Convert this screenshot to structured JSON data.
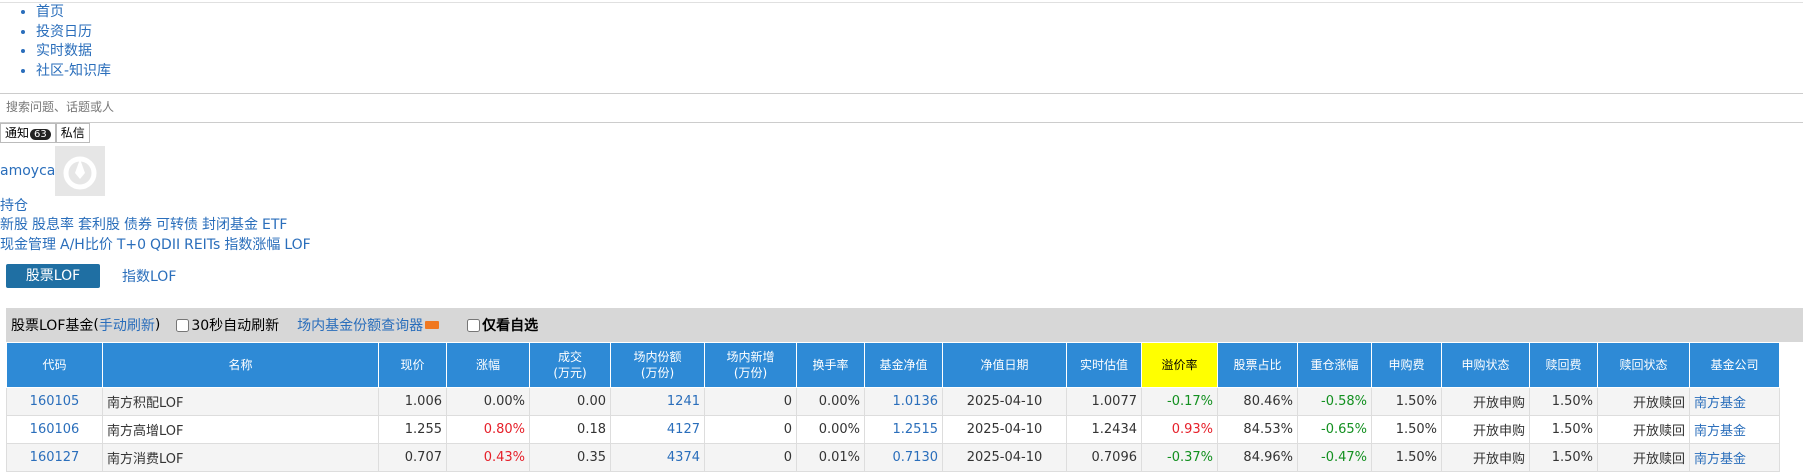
{
  "nav": {
    "items": [
      "首页",
      "投资日历",
      "实时数据",
      "社区-知识库"
    ]
  },
  "search": {
    "placeholder": "搜索问题、话题或人"
  },
  "messages": {
    "notify_label": "通知",
    "notify_count": "63",
    "private_label": "私信"
  },
  "user": {
    "name": "amoyca"
  },
  "hold_link": "持仓",
  "links_row1": [
    "新股",
    "股息率",
    "套利股",
    "债券",
    "可转债",
    "封闭基金",
    "ETF"
  ],
  "links_row2": [
    "现金管理",
    "A/H比价",
    "T+0",
    "QDII",
    "REITs",
    "指数涨幅",
    "LOF"
  ],
  "subtabs": {
    "active": "股票LOF",
    "other": "指数LOF"
  },
  "panel": {
    "title": "股票LOF基金",
    "refresh_label": "手动刷新",
    "auto_refresh_label": "30秒自动刷新",
    "query_link": "场内基金份额查询器",
    "only_watch_label": "仅看自选"
  },
  "table": {
    "headers": [
      {
        "l1": "代码",
        "l2": ""
      },
      {
        "l1": "名称",
        "l2": ""
      },
      {
        "l1": "现价",
        "l2": ""
      },
      {
        "l1": "涨幅",
        "l2": ""
      },
      {
        "l1": "成交",
        "l2": "(万元)"
      },
      {
        "l1": "场内份额",
        "l2": "(万份)"
      },
      {
        "l1": "场内新增",
        "l2": "(万份)"
      },
      {
        "l1": "换手率",
        "l2": ""
      },
      {
        "l1": "基金净值",
        "l2": ""
      },
      {
        "l1": "净值日期",
        "l2": ""
      },
      {
        "l1": "实时估值",
        "l2": ""
      },
      {
        "l1": "溢价率",
        "l2": ""
      },
      {
        "l1": "股票占比",
        "l2": ""
      },
      {
        "l1": "重仓涨幅",
        "l2": ""
      },
      {
        "l1": "申购费",
        "l2": ""
      },
      {
        "l1": "申购状态",
        "l2": ""
      },
      {
        "l1": "赎回费",
        "l2": ""
      },
      {
        "l1": "赎回状态",
        "l2": ""
      },
      {
        "l1": "基金公司",
        "l2": ""
      }
    ],
    "rows": [
      {
        "code": "160105",
        "name": "南方积配LOF",
        "price": "1.006",
        "change": "0.00%",
        "volume": "0.00",
        "shares": "1241",
        "new_shares": "0",
        "turnover": "0.00%",
        "nav": "1.0136",
        "nav_date": "2025-04-10",
        "estimate": "1.0077",
        "premium": "-0.17%",
        "stock_ratio": "80.46%",
        "heavy_change": "-0.58%",
        "buy_fee": "1.50%",
        "buy_status": "开放申购",
        "redeem_fee": "1.50%",
        "redeem_status": "开放赎回",
        "company": "南方基金"
      },
      {
        "code": "160106",
        "name": "南方高增LOF",
        "price": "1.255",
        "change": "0.80%",
        "volume": "0.18",
        "shares": "4127",
        "new_shares": "0",
        "turnover": "0.00%",
        "nav": "1.2515",
        "nav_date": "2025-04-10",
        "estimate": "1.2434",
        "premium": "0.93%",
        "stock_ratio": "84.53%",
        "heavy_change": "-0.65%",
        "buy_fee": "1.50%",
        "buy_status": "开放申购",
        "redeem_fee": "1.50%",
        "redeem_status": "开放赎回",
        "company": "南方基金"
      },
      {
        "code": "160127",
        "name": "南方消费LOF",
        "price": "0.707",
        "change": "0.43%",
        "volume": "0.35",
        "shares": "4374",
        "new_shares": "0",
        "turnover": "0.01%",
        "nav": "0.7130",
        "nav_date": "2025-04-10",
        "estimate": "0.7096",
        "premium": "-0.37%",
        "stock_ratio": "84.96%",
        "heavy_change": "-0.47%",
        "buy_fee": "1.50%",
        "buy_status": "开放申购",
        "redeem_fee": "1.50%",
        "redeem_status": "开放赎回",
        "company": "南方基金"
      }
    ]
  },
  "colors": {
    "header_bg": "#2e8ad6",
    "highlight": "#ffff00",
    "up": "#e6202a",
    "down": "#139020",
    "link": "#2a6ebb",
    "tab_active": "#1f6fa3"
  }
}
